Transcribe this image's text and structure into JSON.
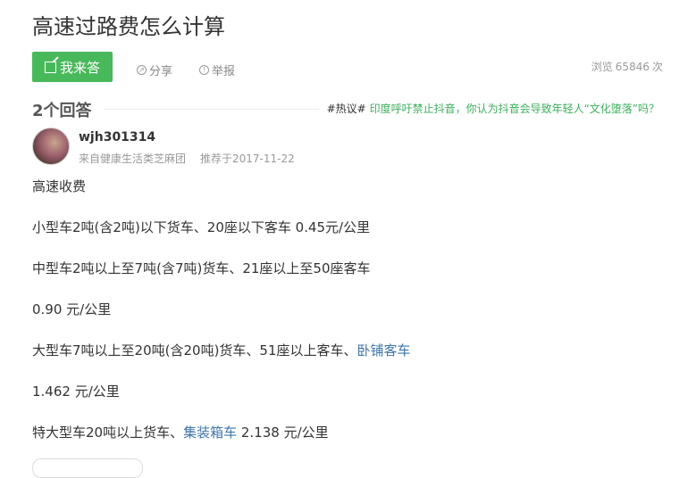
{
  "question": {
    "title": "高速过路费怎么计算"
  },
  "actions": {
    "answer_label": "我来答",
    "share_label": "分享",
    "report_label": "举报"
  },
  "stats": {
    "views_label": "浏览",
    "views_count": "65846",
    "views_unit": "次"
  },
  "answers": {
    "count_label": "2个回答",
    "hot_tag": "#热议#",
    "hot_text": "印度呼吁禁止抖音，你认为抖音会导致年轻人“文化堕落”吗？"
  },
  "answer": {
    "username": "wjh301314",
    "source": "来自健康生活类芝麻团",
    "recommend": "推荐于2017-11-22",
    "lines": {
      "l1": "高速收费",
      "l2": "小型车2吨(含2吨)以下货车、20座以下客车 0.45元/公里",
      "l3": "中型车2吨以上至7吨(含7吨)货车、21座以上至50座客车",
      "l4": "0.90 元/公里",
      "l5a": "大型车7吨以上至20吨(含20吨)货车、51座以上客车、",
      "l5link": "卧铺客车",
      "l6": "1.462 元/公里",
      "l7a": "特大型车20吨以上货车、",
      "l7link": "集装箱车",
      "l7b": " 2.138 元/公里"
    }
  },
  "colors": {
    "green": "#48b95a",
    "link": "#3e76a9",
    "hot_link": "#3eaf5c"
  },
  "icons": {
    "answer": "edit-icon",
    "share": "share-icon",
    "report": "warning-icon"
  }
}
